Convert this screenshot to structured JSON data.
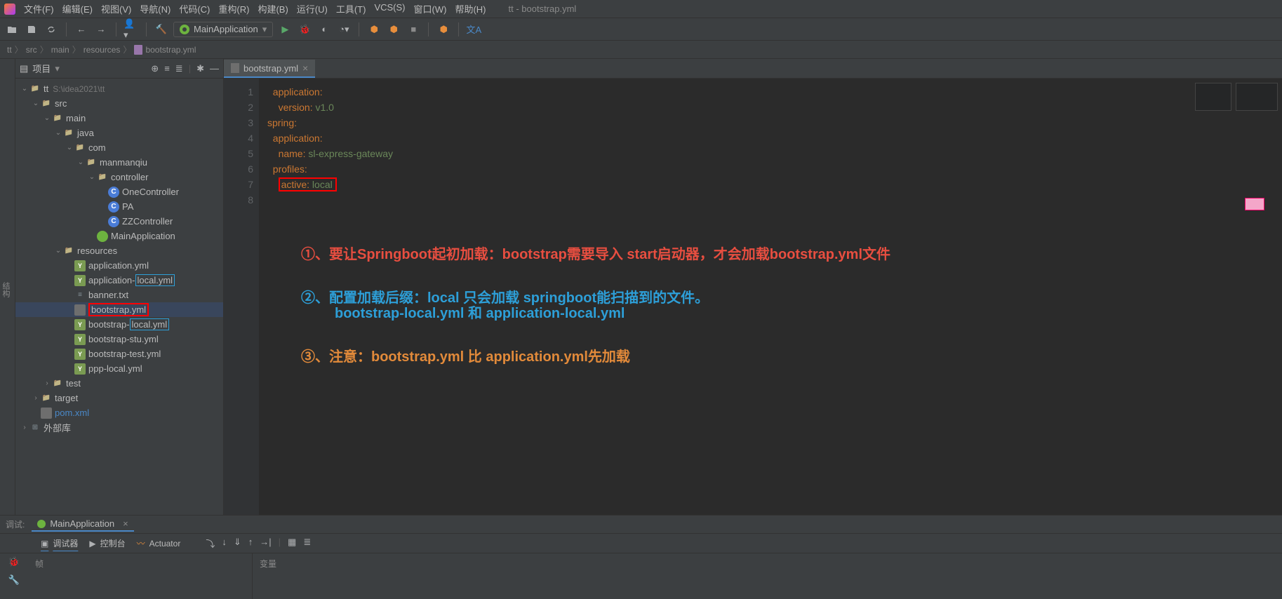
{
  "window": {
    "title": "tt - bootstrap.yml"
  },
  "menu": [
    "文件(F)",
    "编辑(E)",
    "视图(V)",
    "导航(N)",
    "代码(C)",
    "重构(R)",
    "构建(B)",
    "运行(U)",
    "工具(T)",
    "VCS(S)",
    "窗口(W)",
    "帮助(H)"
  ],
  "run_config": {
    "label": "MainApplication"
  },
  "breadcrumb": [
    "tt",
    "src",
    "main",
    "resources",
    "bootstrap.yml"
  ],
  "sidebar": {
    "title": "项目",
    "tree": [
      {
        "d": 0,
        "exp": "v",
        "icon": "folder",
        "name": "tt",
        "path": "S:\\idea2021\\tt"
      },
      {
        "d": 1,
        "exp": "v",
        "icon": "folder",
        "name": "src"
      },
      {
        "d": 2,
        "exp": "v",
        "icon": "folder",
        "name": "main"
      },
      {
        "d": 3,
        "exp": "v",
        "icon": "folder",
        "name": "java"
      },
      {
        "d": 4,
        "exp": "v",
        "icon": "folder",
        "name": "com"
      },
      {
        "d": 5,
        "exp": "v",
        "icon": "folder",
        "name": "manmanqiu"
      },
      {
        "d": 6,
        "exp": "v",
        "icon": "folder",
        "name": "controller"
      },
      {
        "d": 7,
        "exp": "",
        "icon": "class",
        "name": "OneController"
      },
      {
        "d": 7,
        "exp": "",
        "icon": "class",
        "name": "PA"
      },
      {
        "d": 7,
        "exp": "",
        "icon": "class",
        "name": "ZZController"
      },
      {
        "d": 6,
        "exp": "",
        "icon": "spring",
        "name": "MainApplication"
      },
      {
        "d": 3,
        "exp": "v",
        "icon": "folder",
        "name": "resources"
      },
      {
        "d": 4,
        "exp": "",
        "icon": "yaml",
        "name": "application.yml"
      },
      {
        "d": 4,
        "exp": "",
        "icon": "yaml",
        "name": "application-local.yml",
        "hl": "blue",
        "hlText": "local.yml"
      },
      {
        "d": 4,
        "exp": "",
        "icon": "txt",
        "name": "banner.txt"
      },
      {
        "d": 4,
        "exp": "",
        "icon": "file",
        "name": "bootstrap.yml",
        "hl": "red",
        "sel": true
      },
      {
        "d": 4,
        "exp": "",
        "icon": "yaml",
        "name": "bootstrap-local.yml",
        "hl": "blue",
        "hlText": "local.yml"
      },
      {
        "d": 4,
        "exp": "",
        "icon": "yaml",
        "name": "bootstrap-stu.yml"
      },
      {
        "d": 4,
        "exp": "",
        "icon": "yaml",
        "name": "bootstrap-test.yml"
      },
      {
        "d": 4,
        "exp": "",
        "icon": "yaml",
        "name": "ppp-local.yml"
      },
      {
        "d": 2,
        "exp": ">",
        "icon": "folder",
        "name": "test"
      },
      {
        "d": 1,
        "exp": ">",
        "icon": "folder",
        "name": "target"
      },
      {
        "d": 1,
        "exp": "",
        "icon": "file",
        "name": "pom.xml",
        "blue": true
      },
      {
        "d": 0,
        "exp": ">",
        "icon": "lib",
        "name": "外部库"
      }
    ]
  },
  "tab": {
    "name": "bootstrap.yml"
  },
  "code_lines": [
    {
      "n": 1,
      "segments": [
        {
          "t": "  ",
          "c": ""
        },
        {
          "t": "application",
          "c": "key"
        },
        {
          "t": ":",
          "c": "colon"
        }
      ]
    },
    {
      "n": 2,
      "segments": [
        {
          "t": "    ",
          "c": ""
        },
        {
          "t": "version",
          "c": "key"
        },
        {
          "t": ": ",
          "c": "colon"
        },
        {
          "t": "v1.0",
          "c": "val"
        }
      ]
    },
    {
      "n": 3,
      "segments": [
        {
          "t": "spring",
          "c": "key"
        },
        {
          "t": ":",
          "c": "colon"
        }
      ]
    },
    {
      "n": 4,
      "segments": [
        {
          "t": "  ",
          "c": ""
        },
        {
          "t": "application",
          "c": "key"
        },
        {
          "t": ":",
          "c": "colon"
        }
      ]
    },
    {
      "n": 5,
      "segments": [
        {
          "t": "    ",
          "c": ""
        },
        {
          "t": "name",
          "c": "key"
        },
        {
          "t": ": ",
          "c": "colon"
        },
        {
          "t": "sl-express-gateway",
          "c": "val"
        }
      ]
    },
    {
      "n": 6,
      "segments": [
        {
          "t": "  ",
          "c": ""
        },
        {
          "t": "profiles",
          "c": "key"
        },
        {
          "t": ":",
          "c": "colon"
        }
      ]
    },
    {
      "n": 7,
      "segments": [
        {
          "t": "    ",
          "c": ""
        },
        {
          "t": "active",
          "c": "key"
        },
        {
          "t": ": ",
          "c": "colon"
        },
        {
          "t": "local",
          "c": "val"
        }
      ],
      "box": true
    },
    {
      "n": 8,
      "segments": []
    }
  ],
  "annotations": {
    "a1": "①、要让Springboot起初加载：bootstrap需要导入 start启动器，才会加载bootstrap.yml文件",
    "a2a": "②、配置加载后缀：local 只会加载 springboot能扫描到的文件。",
    "a2b": "bootstrap-local.yml 和 application-local.yml",
    "a3": "③、注意：bootstrap.yml 比 application.yml先加载"
  },
  "debug": {
    "label": "调试:",
    "config": "MainApplication",
    "tabs": [
      "调试器",
      "控制台",
      "Actuator"
    ],
    "frames_label": "帧",
    "vars_label": "变量"
  },
  "leftgutter": "结构"
}
